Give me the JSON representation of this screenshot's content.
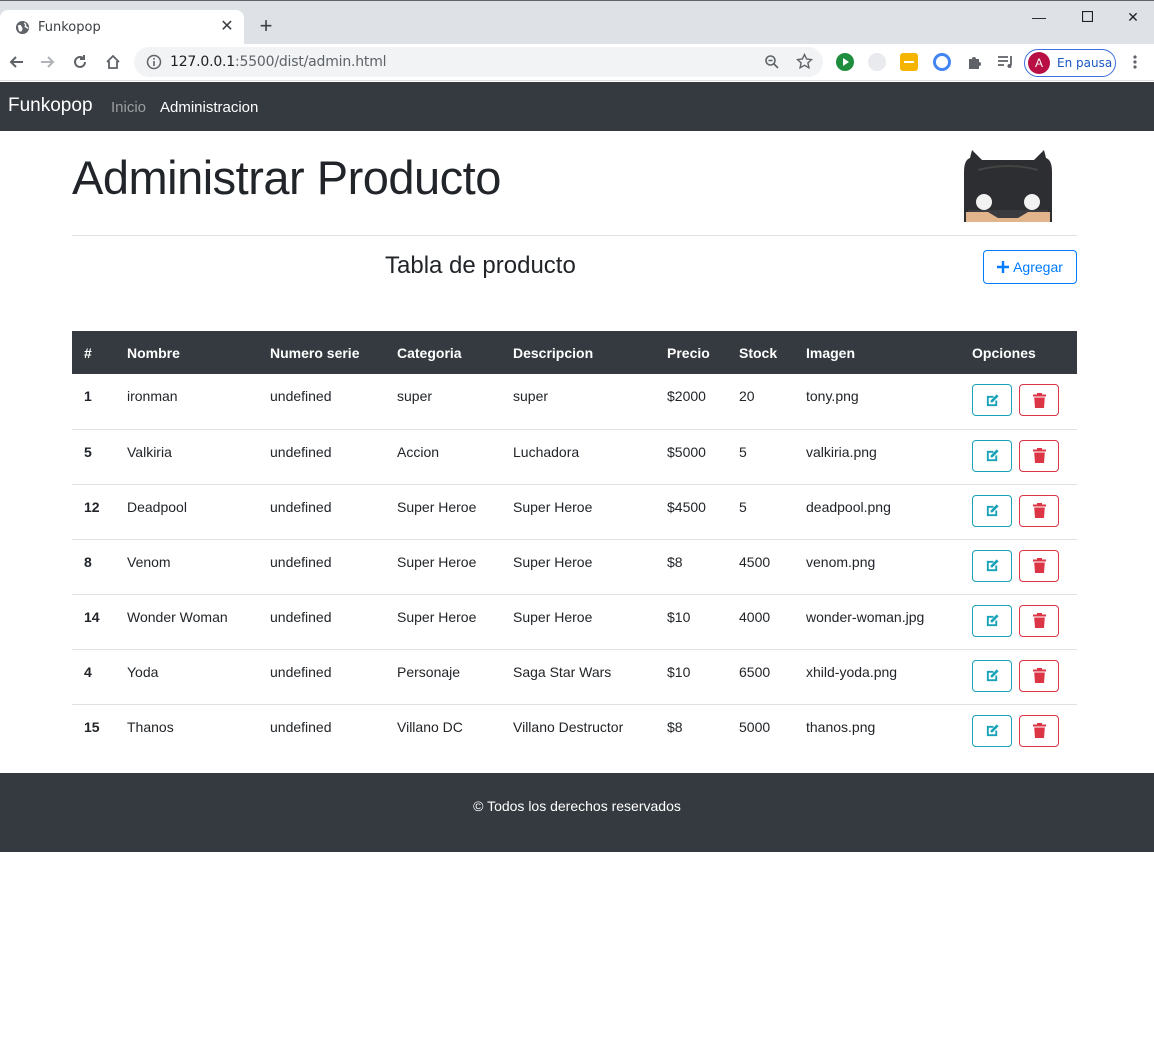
{
  "browser": {
    "tab_title": "Funkopop",
    "url_host": "127.0.0.1",
    "url_rest": ":5500/dist/admin.html",
    "profile_initial": "A",
    "profile_label": "En pausa"
  },
  "navbar": {
    "brand": "Funkopop",
    "links": [
      {
        "label": "Inicio",
        "active": false
      },
      {
        "label": "Administracion",
        "active": true
      }
    ],
    "bg": "#343a40"
  },
  "main": {
    "title": "Administrar Producto",
    "section_title": "Tabla de producto",
    "add_label": "Agregar"
  },
  "table": {
    "headers": [
      "#",
      "Nombre",
      "Numero serie",
      "Categoria",
      "Descripcion",
      "Precio",
      "Stock",
      "Imagen",
      "Opciones"
    ],
    "rows": [
      [
        "1",
        "ironman",
        "undefined",
        "super",
        "super",
        "$2000",
        "20",
        "tony.png"
      ],
      [
        "5",
        "Valkiria",
        "undefined",
        "Accion",
        "Luchadora",
        "$5000",
        "5",
        "valkiria.png"
      ],
      [
        "12",
        "Deadpool",
        "undefined",
        "Super Heroe",
        "Super Heroe",
        "$4500",
        "5",
        "deadpool.png"
      ],
      [
        "8",
        "Venom",
        "undefined",
        "Super Heroe",
        "Super Heroe",
        "$8",
        "4500",
        "venom.png"
      ],
      [
        "14",
        "Wonder Woman",
        "undefined",
        "Super Heroe",
        "Super Heroe",
        "$10",
        "4000",
        "wonder-woman.jpg"
      ],
      [
        "4",
        "Yoda",
        "undefined",
        "Personaje",
        "Saga Star Wars",
        "$10",
        "6500",
        "xhild-yoda.png"
      ],
      [
        "15",
        "Thanos",
        "undefined",
        "Villano DC",
        "Villano Destructor",
        "$8",
        "5000",
        "thanos.png"
      ]
    ]
  },
  "footer": {
    "text": "© Todos los derechos reservados"
  },
  "colors": {
    "accent_blue": "#007bff",
    "edit_teal": "#17a2b8",
    "delete_red": "#dc3545"
  }
}
